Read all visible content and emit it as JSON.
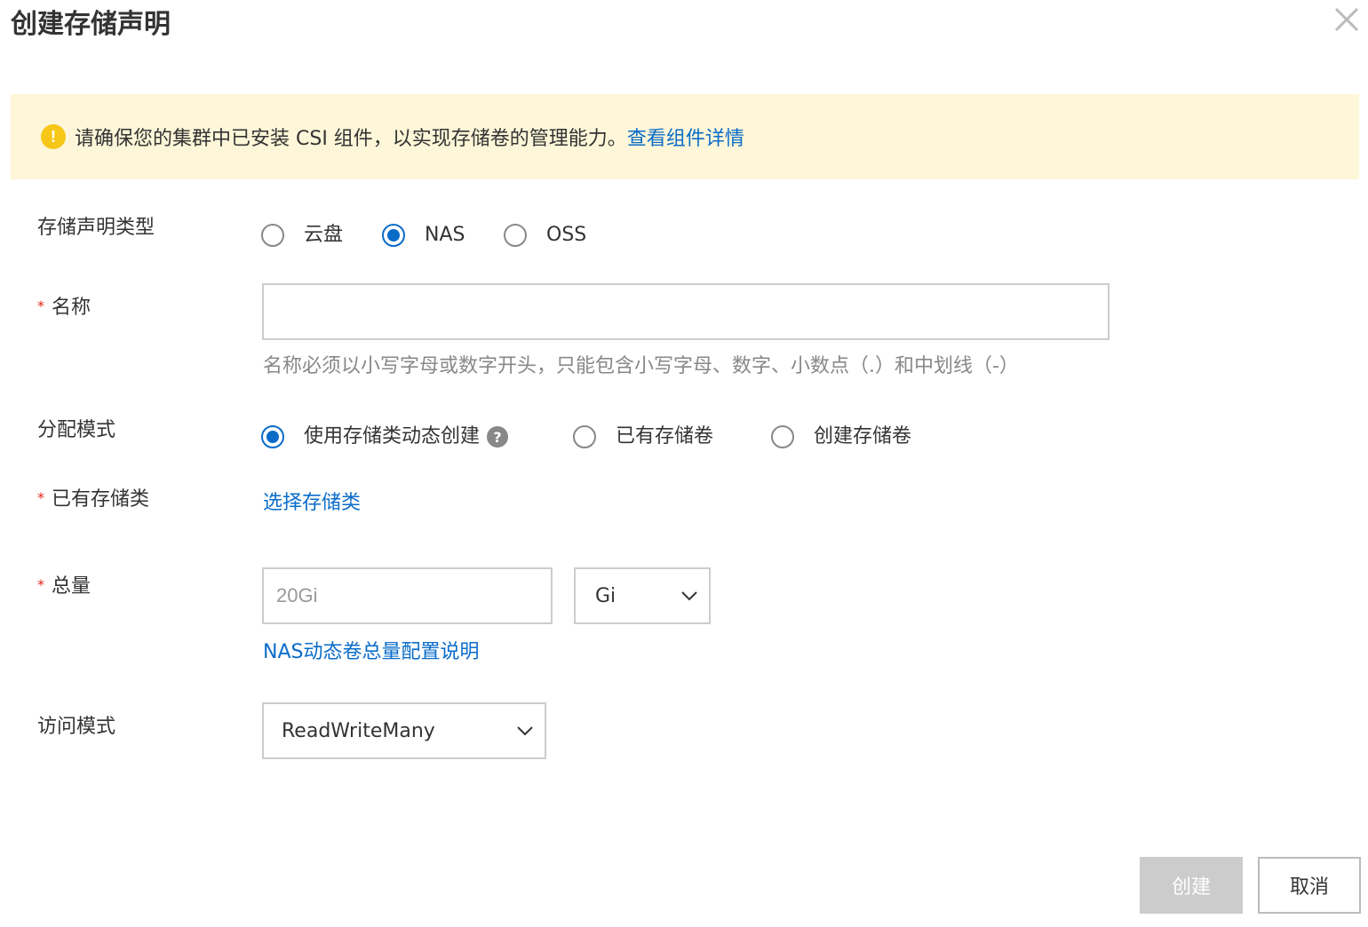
{
  "dialog": {
    "title": "创建存储声明"
  },
  "notice": {
    "icon": "warning-icon",
    "icon_glyph": "!",
    "text": "请确保您的集群中已安装 CSI 组件，以实现存储卷的管理能力。",
    "link": "查看组件详情"
  },
  "form": {
    "type": {
      "label": "存储声明类型",
      "options": [
        "云盘",
        "NAS",
        "OSS"
      ],
      "selected": "NAS"
    },
    "name": {
      "label": "名称",
      "value": "",
      "hint": "名称必须以小写字母或数字开头，只能包含小写字母、数字、小数点（.）和中划线（-）"
    },
    "allocation": {
      "label": "分配模式",
      "options": [
        "使用存储类动态创建",
        "已有存储卷",
        "创建存储卷"
      ],
      "selected": "使用存储类动态创建",
      "help_glyph": "?"
    },
    "storage_class": {
      "label": "已有存储类",
      "link": "选择存储类"
    },
    "capacity": {
      "label": "总量",
      "placeholder": "20Gi",
      "unit": "Gi",
      "help_link": "NAS动态卷总量配置说明"
    },
    "access_mode": {
      "label": "访问模式",
      "value": "ReadWriteMany"
    }
  },
  "buttons": {
    "create": "创建",
    "cancel": "取消"
  },
  "colors": {
    "accent": "#0a6cc9",
    "notice_bg": "#fdf6d8",
    "warning": "#f7c718",
    "required": "#e2231a",
    "disabled_button": "#cccccc"
  }
}
